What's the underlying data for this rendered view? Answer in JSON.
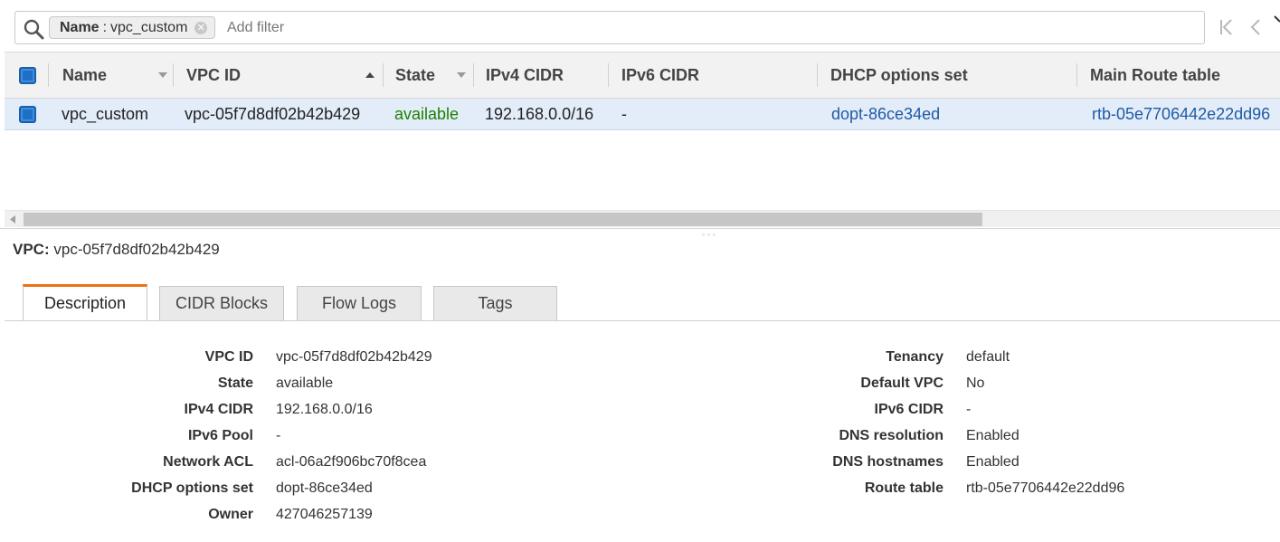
{
  "filter": {
    "chip_key": "Name",
    "chip_separator": ":",
    "chip_value": "vpc_custom",
    "chip_remove_icon": "close-circle-icon",
    "placeholder": "Add filter"
  },
  "pager": {
    "first_icon": "first-page-icon",
    "prev_icon": "chevron-left-icon",
    "next_icon": "chevron-right-icon"
  },
  "table": {
    "columns": [
      "Name",
      "VPC ID",
      "State",
      "IPv4 CIDR",
      "IPv6 CIDR",
      "DHCP options set",
      "Main Route table"
    ],
    "sorted_column": "VPC ID",
    "sort_direction": "ascending",
    "rows": [
      {
        "selected": true,
        "name": "vpc_custom",
        "vpc_id": "vpc-05f7d8df02b42b429",
        "state": "available",
        "ipv4_cidr": "192.168.0.0/16",
        "ipv6_cidr": "-",
        "dhcp_options_set": "dopt-86ce34ed",
        "main_route_table": "rtb-05e7706442e22dd96"
      }
    ]
  },
  "details": {
    "title_label": "VPC:",
    "title_value": "vpc-05f7d8df02b42b429",
    "tabs": [
      "Description",
      "CIDR Blocks",
      "Flow Logs",
      "Tags"
    ],
    "active_tab": "Description",
    "left": [
      {
        "label": "VPC ID",
        "value": "vpc-05f7d8df02b42b429"
      },
      {
        "label": "State",
        "value": "available"
      },
      {
        "label": "IPv4 CIDR",
        "value": "192.168.0.0/16"
      },
      {
        "label": "IPv6 Pool",
        "value": "-"
      },
      {
        "label": "Network ACL",
        "value": "acl-06a2f906bc70f8cea"
      },
      {
        "label": "DHCP options set",
        "value": "dopt-86ce34ed"
      },
      {
        "label": "Owner",
        "value": "427046257139"
      }
    ],
    "right": [
      {
        "label": "Tenancy",
        "value": "default"
      },
      {
        "label": "Default VPC",
        "value": "No"
      },
      {
        "label": "IPv6 CIDR",
        "value": "-"
      },
      {
        "label": "DNS resolution",
        "value": "Enabled"
      },
      {
        "label": "DNS hostnames",
        "value": "Enabled"
      },
      {
        "label": "Route table",
        "value": "rtb-05e7706442e22dd96"
      }
    ]
  },
  "colors": {
    "status_green": "#1d8102",
    "link_blue": "#1f5aa6",
    "selected_row": "#e3edf9",
    "active_tab_accent": "#ec7211",
    "checkbox_blue": "#1f6fc5"
  }
}
